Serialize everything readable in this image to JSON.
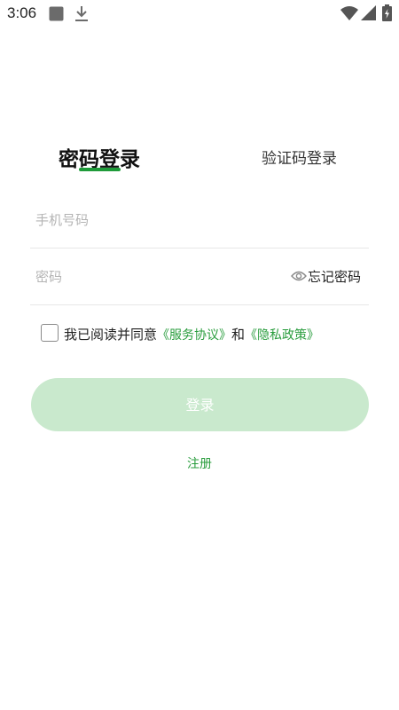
{
  "status_bar": {
    "time": "3:06",
    "icons": [
      "app-square-icon",
      "download-icon",
      "wifi-icon",
      "signal-icon",
      "battery-icon"
    ]
  },
  "tabs": {
    "active_label": "密码登录",
    "inactive_label": "验证码登录"
  },
  "form": {
    "phone_placeholder": "手机号码",
    "phone_value": "",
    "password_placeholder": "密码",
    "password_value": "",
    "forgot_label": "忘记密码"
  },
  "agreement": {
    "prefix": "我已阅读并同意",
    "service_link": "《服务协议》",
    "conjunction": "和",
    "privacy_link": "《隐私政策》",
    "checked": false
  },
  "actions": {
    "login_label": "登录",
    "register_label": "注册"
  },
  "colors": {
    "accent": "#2a9d3e",
    "underline": "#1f9b3a",
    "button_disabled_bg": "#c9e9cd",
    "placeholder": "#b4b4b4",
    "divider": "#e7e7e7"
  }
}
